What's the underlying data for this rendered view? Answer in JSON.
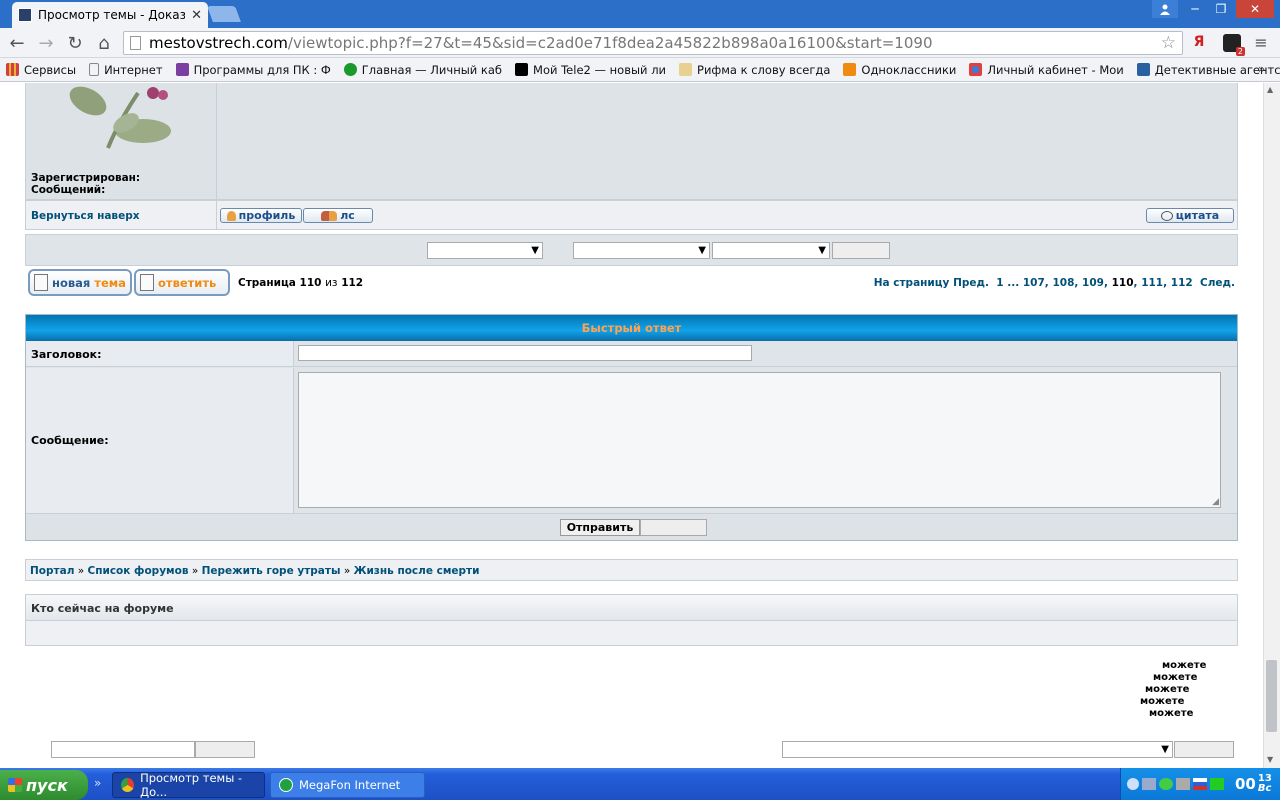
{
  "browser": {
    "tab_title": "Просмотр темы - Доказате",
    "tab_close": "✕",
    "url_host": "mestovstrech.com",
    "url_path": "/viewtopic.php?f=27&t=45&sid=c2ad0e71f8dea2a45822b898a0a16100&start=1090",
    "window_controls": [
      "─",
      "❐",
      "✕"
    ],
    "bookmarks": [
      {
        "label": "Сервисы",
        "color": "#d04040"
      },
      {
        "label": "Интернет",
        "color": "#888888"
      },
      {
        "label": "Программы для ПК : Ф",
        "color": "#7a3fa0"
      },
      {
        "label": "Главная — Личный каб",
        "color": "#1a9a2a"
      },
      {
        "label": "Мой Tele2 — новый ли",
        "color": "#000000"
      },
      {
        "label": "Рифма к слову всегда",
        "color": "#d4a030"
      },
      {
        "label": "Одноклассники",
        "color": "#f08a10"
      },
      {
        "label": "Личный кабинет - Мои",
        "color": "#3a7ad8"
      },
      {
        "label": "Детективные агентсте",
        "color": "#2a5fa0"
      }
    ],
    "bookmarks_more": "»"
  },
  "post": {
    "registered_label": "Зарегистрирован:",
    "messages_label": "Сообщений:",
    "back_to_top": "Вернуться наверх",
    "profile_btn": "профиль",
    "pm_btn": "лс",
    "quote_btn": "цитата"
  },
  "pagination": {
    "new_topic": "новая",
    "new_topic_accent": "тема",
    "reply": "ответить",
    "page_info_prefix": "Страница",
    "current_page": "110",
    "page_info_of": "из",
    "total_pages": "112",
    "goto_label": "На страницу",
    "prev": "Пред.",
    "first": "1",
    "ellipsis": "...",
    "pages": [
      "107",
      "108",
      "109",
      "110",
      "111",
      "112"
    ],
    "next": "След."
  },
  "quick_reply": {
    "header": "Быстрый ответ",
    "subject_label": "Заголовок:",
    "message_label": "Сообщение:",
    "submit": "Отправить"
  },
  "breadcrumb": {
    "items": [
      "Портал",
      "Список форумов",
      "Пережить горе утраты",
      "Жизнь после смерти"
    ],
    "separator": "»"
  },
  "who_online": {
    "title": "Кто сейчас на форуме"
  },
  "permissions": [
    "можете",
    "можете",
    "можете",
    "можете",
    "можете"
  ],
  "taskbar": {
    "start": "пуск",
    "tasks": [
      "Просмотр темы - До...",
      "MegaFon Internet"
    ],
    "clock_time": "00",
    "clock_min": "13",
    "clock_day": "Вс"
  }
}
